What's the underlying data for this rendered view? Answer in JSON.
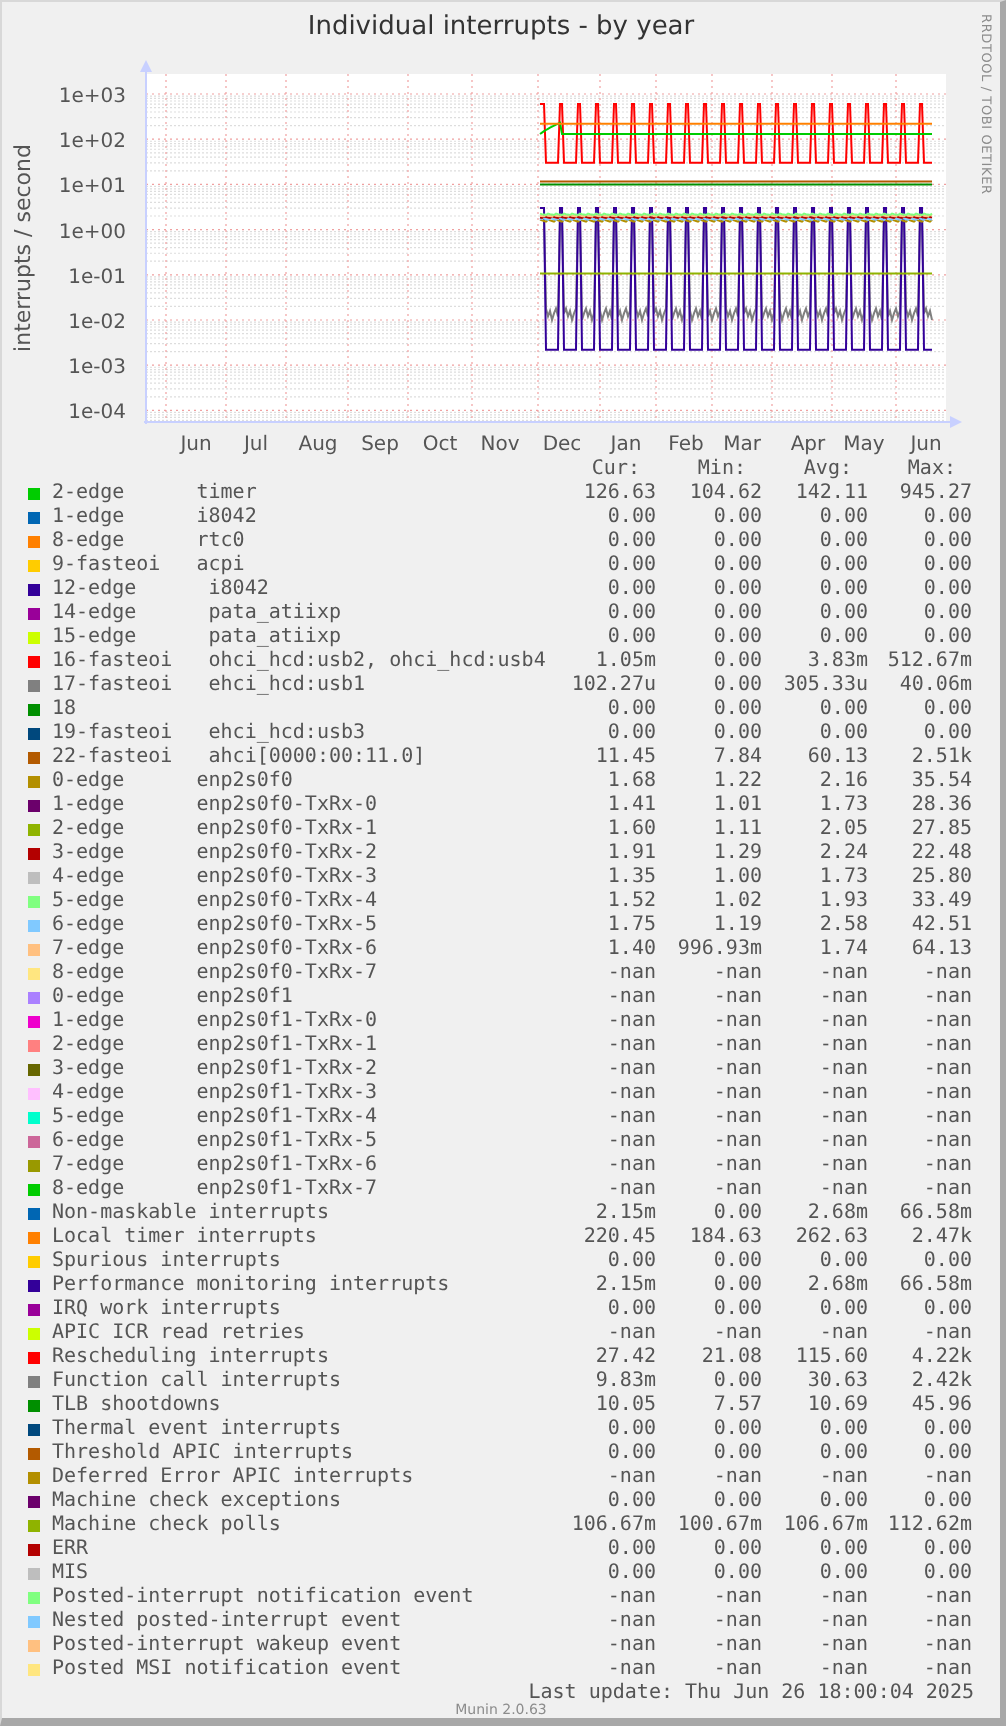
{
  "graph": {
    "title": "Individual interrupts - by year",
    "side_text": "RRDTOOL / TOBI OETIKER",
    "y_axis_label": "interrupts / second",
    "y_tick_labels": [
      "1e+03",
      "1e+02",
      "1e+01",
      "1e+00",
      "1e-01",
      "1e-02",
      "1e-03",
      "1e-04"
    ],
    "x_tick_labels": [
      "Jun",
      "Jul",
      "Aug",
      "Sep",
      "Oct",
      "Nov",
      "Dec",
      "Jan",
      "Feb",
      "Mar",
      "Apr",
      "May",
      "Jun"
    ]
  },
  "legend": {
    "columns": [
      "Cur:",
      "Min:",
      "Avg:",
      "Max:"
    ],
    "rows": [
      {
        "label": "2-edge      timer",
        "color": "#00cc00",
        "cur": "126.63",
        "min": "104.62",
        "avg": "142.11",
        "max": "945.27"
      },
      {
        "label": "1-edge      i8042",
        "color": "#0066b3",
        "cur": "0.00",
        "min": "0.00",
        "avg": "0.00",
        "max": "0.00"
      },
      {
        "label": "8-edge      rtc0",
        "color": "#ff8000",
        "cur": "0.00",
        "min": "0.00",
        "avg": "0.00",
        "max": "0.00"
      },
      {
        "label": "9-fasteoi   acpi",
        "color": "#ffcc00",
        "cur": "0.00",
        "min": "0.00",
        "avg": "0.00",
        "max": "0.00"
      },
      {
        "label": "12-edge      i8042",
        "color": "#330099",
        "cur": "0.00",
        "min": "0.00",
        "avg": "0.00",
        "max": "0.00"
      },
      {
        "label": "14-edge      pata_atiixp",
        "color": "#990099",
        "cur": "0.00",
        "min": "0.00",
        "avg": "0.00",
        "max": "0.00"
      },
      {
        "label": "15-edge      pata_atiixp",
        "color": "#ccff00",
        "cur": "0.00",
        "min": "0.00",
        "avg": "0.00",
        "max": "0.00"
      },
      {
        "label": "16-fasteoi   ohci_hcd:usb2, ohci_hcd:usb4",
        "color": "#ff0000",
        "cur": "1.05m",
        "min": "0.00",
        "avg": "3.83m",
        "max": "512.67m"
      },
      {
        "label": "17-fasteoi   ehci_hcd:usb1",
        "color": "#808080",
        "cur": "102.27u",
        "min": "0.00",
        "avg": "305.33u",
        "max": "40.06m"
      },
      {
        "label": "18",
        "color": "#008f00",
        "cur": "0.00",
        "min": "0.00",
        "avg": "0.00",
        "max": "0.00"
      },
      {
        "label": "19-fasteoi   ehci_hcd:usb3",
        "color": "#00487d",
        "cur": "0.00",
        "min": "0.00",
        "avg": "0.00",
        "max": "0.00"
      },
      {
        "label": "22-fasteoi   ahci[0000:00:11.0]",
        "color": "#b35a00",
        "cur": "11.45",
        "min": "7.84",
        "avg": "60.13",
        "max": "2.51k"
      },
      {
        "label": "0-edge      enp2s0f0",
        "color": "#b38f00",
        "cur": "1.68",
        "min": "1.22",
        "avg": "2.16",
        "max": "35.54"
      },
      {
        "label": "1-edge      enp2s0f0-TxRx-0",
        "color": "#6b006b",
        "cur": "1.41",
        "min": "1.01",
        "avg": "1.73",
        "max": "28.36"
      },
      {
        "label": "2-edge      enp2s0f0-TxRx-1",
        "color": "#8fb300",
        "cur": "1.60",
        "min": "1.11",
        "avg": "2.05",
        "max": "27.85"
      },
      {
        "label": "3-edge      enp2s0f0-TxRx-2",
        "color": "#b30000",
        "cur": "1.91",
        "min": "1.29",
        "avg": "2.24",
        "max": "22.48"
      },
      {
        "label": "4-edge      enp2s0f0-TxRx-3",
        "color": "#bebebe",
        "cur": "1.35",
        "min": "1.00",
        "avg": "1.73",
        "max": "25.80"
      },
      {
        "label": "5-edge      enp2s0f0-TxRx-4",
        "color": "#80ff80",
        "cur": "1.52",
        "min": "1.02",
        "avg": "1.93",
        "max": "33.49"
      },
      {
        "label": "6-edge      enp2s0f0-TxRx-5",
        "color": "#80c9ff",
        "cur": "1.75",
        "min": "1.19",
        "avg": "2.58",
        "max": "42.51"
      },
      {
        "label": "7-edge      enp2s0f0-TxRx-6",
        "color": "#ffc080",
        "cur": "1.40",
        "min": "996.93m",
        "avg": "1.74",
        "max": "64.13"
      },
      {
        "label": "8-edge      enp2s0f0-TxRx-7",
        "color": "#ffe680",
        "cur": "-nan",
        "min": "-nan",
        "avg": "-nan",
        "max": "-nan"
      },
      {
        "label": "0-edge      enp2s0f1",
        "color": "#aa80ff",
        "cur": "-nan",
        "min": "-nan",
        "avg": "-nan",
        "max": "-nan"
      },
      {
        "label": "1-edge      enp2s0f1-TxRx-0",
        "color": "#ee00cc",
        "cur": "-nan",
        "min": "-nan",
        "avg": "-nan",
        "max": "-nan"
      },
      {
        "label": "2-edge      enp2s0f1-TxRx-1",
        "color": "#ff8080",
        "cur": "-nan",
        "min": "-nan",
        "avg": "-nan",
        "max": "-nan"
      },
      {
        "label": "3-edge      enp2s0f1-TxRx-2",
        "color": "#666600",
        "cur": "-nan",
        "min": "-nan",
        "avg": "-nan",
        "max": "-nan"
      },
      {
        "label": "4-edge      enp2s0f1-TxRx-3",
        "color": "#ffbfff",
        "cur": "-nan",
        "min": "-nan",
        "avg": "-nan",
        "max": "-nan"
      },
      {
        "label": "5-edge      enp2s0f1-TxRx-4",
        "color": "#00ffcc",
        "cur": "-nan",
        "min": "-nan",
        "avg": "-nan",
        "max": "-nan"
      },
      {
        "label": "6-edge      enp2s0f1-TxRx-5",
        "color": "#cc6699",
        "cur": "-nan",
        "min": "-nan",
        "avg": "-nan",
        "max": "-nan"
      },
      {
        "label": "7-edge      enp2s0f1-TxRx-6",
        "color": "#999900",
        "cur": "-nan",
        "min": "-nan",
        "avg": "-nan",
        "max": "-nan"
      },
      {
        "label": "8-edge      enp2s0f1-TxRx-7",
        "color": "#00cc00",
        "cur": "-nan",
        "min": "-nan",
        "avg": "-nan",
        "max": "-nan"
      },
      {
        "label": "Non-maskable interrupts",
        "color": "#0066b3",
        "cur": "2.15m",
        "min": "0.00",
        "avg": "2.68m",
        "max": "66.58m"
      },
      {
        "label": "Local timer interrupts",
        "color": "#ff8000",
        "cur": "220.45",
        "min": "184.63",
        "avg": "262.63",
        "max": "2.47k"
      },
      {
        "label": "Spurious interrupts",
        "color": "#ffcc00",
        "cur": "0.00",
        "min": "0.00",
        "avg": "0.00",
        "max": "0.00"
      },
      {
        "label": "Performance monitoring interrupts",
        "color": "#330099",
        "cur": "2.15m",
        "min": "0.00",
        "avg": "2.68m",
        "max": "66.58m"
      },
      {
        "label": "IRQ work interrupts",
        "color": "#990099",
        "cur": "0.00",
        "min": "0.00",
        "avg": "0.00",
        "max": "0.00"
      },
      {
        "label": "APIC ICR read retries",
        "color": "#ccff00",
        "cur": "-nan",
        "min": "-nan",
        "avg": "-nan",
        "max": "-nan"
      },
      {
        "label": "Rescheduling interrupts",
        "color": "#ff0000",
        "cur": "27.42",
        "min": "21.08",
        "avg": "115.60",
        "max": "4.22k"
      },
      {
        "label": "Function call interrupts",
        "color": "#808080",
        "cur": "9.83m",
        "min": "0.00",
        "avg": "30.63",
        "max": "2.42k"
      },
      {
        "label": "TLB shootdowns",
        "color": "#008f00",
        "cur": "10.05",
        "min": "7.57",
        "avg": "10.69",
        "max": "45.96"
      },
      {
        "label": "Thermal event interrupts",
        "color": "#00487d",
        "cur": "0.00",
        "min": "0.00",
        "avg": "0.00",
        "max": "0.00"
      },
      {
        "label": "Threshold APIC interrupts",
        "color": "#b35a00",
        "cur": "0.00",
        "min": "0.00",
        "avg": "0.00",
        "max": "0.00"
      },
      {
        "label": "Deferred Error APIC interrupts",
        "color": "#b38f00",
        "cur": "-nan",
        "min": "-nan",
        "avg": "-nan",
        "max": "-nan"
      },
      {
        "label": "Machine check exceptions",
        "color": "#6b006b",
        "cur": "0.00",
        "min": "0.00",
        "avg": "0.00",
        "max": "0.00"
      },
      {
        "label": "Machine check polls",
        "color": "#8fb300",
        "cur": "106.67m",
        "min": "100.67m",
        "avg": "106.67m",
        "max": "112.62m"
      },
      {
        "label": "ERR",
        "color": "#b30000",
        "cur": "0.00",
        "min": "0.00",
        "avg": "0.00",
        "max": "0.00"
      },
      {
        "label": "MIS",
        "color": "#bebebe",
        "cur": "0.00",
        "min": "0.00",
        "avg": "0.00",
        "max": "0.00"
      },
      {
        "label": "Posted-interrupt notification event",
        "color": "#80ff80",
        "cur": "-nan",
        "min": "-nan",
        "avg": "-nan",
        "max": "-nan"
      },
      {
        "label": "Nested posted-interrupt event",
        "color": "#80c9ff",
        "cur": "-nan",
        "min": "-nan",
        "avg": "-nan",
        "max": "-nan"
      },
      {
        "label": "Posted-interrupt wakeup event",
        "color": "#ffc080",
        "cur": "-nan",
        "min": "-nan",
        "avg": "-nan",
        "max": "-nan"
      },
      {
        "label": "Posted MSI notification event",
        "color": "#ffe680",
        "cur": "-nan",
        "min": "-nan",
        "avg": "-nan",
        "max": "-nan"
      }
    ]
  },
  "last_update": "Last update: Thu Jun 26 18:00:04 2025",
  "footer": "Munin 2.0.63"
}
